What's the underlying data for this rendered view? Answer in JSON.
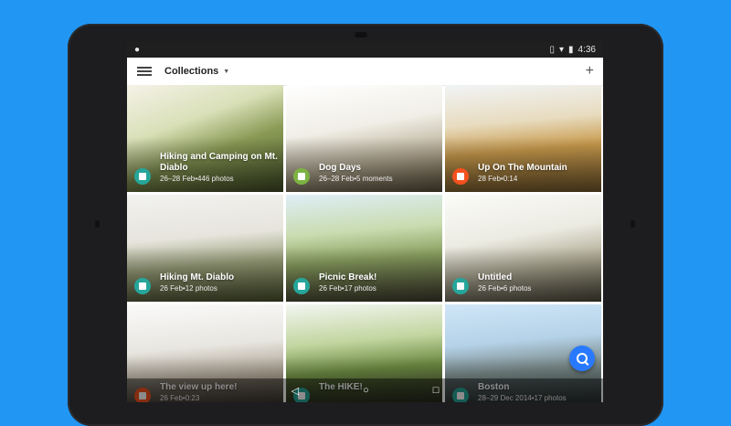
{
  "status_bar": {
    "time": "4:36",
    "icons": [
      "notification-icon",
      "vibrate-icon",
      "wifi-icon",
      "battery-icon"
    ]
  },
  "toolbar": {
    "title": "Collections",
    "add_label": "+"
  },
  "collections": [
    {
      "title": "Hiking and Camping on Mt. Diablo",
      "subtitle": "26–28 Feb•446 photos",
      "badge_color": "#26a69a",
      "icon": "album-icon"
    },
    {
      "title": "Dog Days",
      "subtitle": "26–28 Feb•5 moments",
      "badge_color": "#7cb342",
      "icon": "story-icon"
    },
    {
      "title": "Up On The Mountain",
      "subtitle": "28 Feb•0:14",
      "badge_color": "#f4511e",
      "icon": "movie-icon"
    },
    {
      "title": "Hiking Mt. Diablo",
      "subtitle": "26 Feb•12 photos",
      "badge_color": "#26a69a",
      "icon": "album-icon"
    },
    {
      "title": "Picnic Break!",
      "subtitle": "26 Feb•17 photos",
      "badge_color": "#26a69a",
      "icon": "album-icon"
    },
    {
      "title": "Untitled",
      "subtitle": "26 Feb•6 photos",
      "badge_color": "#26a69a",
      "icon": "album-icon"
    },
    {
      "title": "The view up here!",
      "subtitle": "26 Feb•0:23",
      "badge_color": "#f4511e",
      "icon": "movie-icon"
    },
    {
      "title": "The HIKE!",
      "subtitle": "",
      "badge_color": "#26a69a",
      "icon": "album-icon"
    },
    {
      "title": "Boston",
      "subtitle": "28–29 Dec 2014•17 photos",
      "badge_color": "#26a69a",
      "icon": "album-icon"
    }
  ],
  "nav_bar": {
    "back": "◁",
    "home": "○",
    "recents": "□"
  },
  "colors": {
    "background": "#2196f3",
    "fab": "#2979ff"
  }
}
